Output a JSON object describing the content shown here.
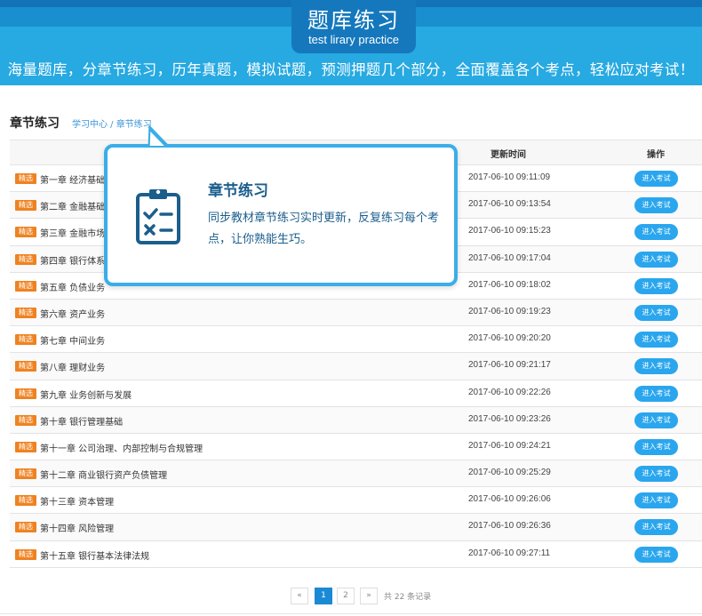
{
  "header": {
    "title_cn": "题库练习",
    "title_en": "test lirary practice",
    "slogan": "海量题库，分章节练习，历年真题，模拟试题，预测押题几个部分，全面覆盖各个考点，轻松应对考试！"
  },
  "section": {
    "title": "章节练习",
    "breadcrumb": "学习中心 / 章节练习"
  },
  "table": {
    "headers": {
      "time": "更新时间",
      "action": "操作"
    },
    "tag_label": "精选",
    "button_label": "进入考试",
    "rows": [
      {
        "chapter": "第一章 经济基础",
        "time": "2017-06-10 09:11:09"
      },
      {
        "chapter": "第二章 金融基础",
        "time": "2017-06-10 09:13:54"
      },
      {
        "chapter": "第三章 金融市场",
        "time": "2017-06-10 09:15:23"
      },
      {
        "chapter": "第四章 银行体系",
        "time": "2017-06-10 09:17:04"
      },
      {
        "chapter": "第五章 负债业务",
        "time": "2017-06-10 09:18:02"
      },
      {
        "chapter": "第六章 资产业务",
        "time": "2017-06-10 09:19:23"
      },
      {
        "chapter": "第七章 中间业务",
        "time": "2017-06-10 09:20:20"
      },
      {
        "chapter": "第八章 理财业务",
        "time": "2017-06-10 09:21:17"
      },
      {
        "chapter": "第九章 业务创新与发展",
        "time": "2017-06-10 09:22:26"
      },
      {
        "chapter": "第十章 银行管理基础",
        "time": "2017-06-10 09:23:26"
      },
      {
        "chapter": "第十一章 公司治理、内部控制与合规管理",
        "time": "2017-06-10 09:24:21"
      },
      {
        "chapter": "第十二章 商业银行资产负债管理",
        "time": "2017-06-10 09:25:29"
      },
      {
        "chapter": "第十三章 资本管理",
        "time": "2017-06-10 09:26:06"
      },
      {
        "chapter": "第十四章 风险管理",
        "time": "2017-06-10 09:26:36"
      },
      {
        "chapter": "第十五章 银行基本法律法规",
        "time": "2017-06-10 09:27:11"
      }
    ]
  },
  "pagination": {
    "prev": "«",
    "pages": [
      "1",
      "2"
    ],
    "current": "1",
    "next": "»",
    "total": "共 22 条记录"
  },
  "callout": {
    "icon": "clipboard-checklist-icon",
    "title": "章节练习",
    "description": "同步教材章节练习实时更新，反复练习每个考点，让你熟能生巧。"
  },
  "colors": {
    "banner": "#27a9e1",
    "banner_dark": "#1578bd",
    "tag": "#ef8220",
    "button": "#2aa6ee",
    "callout_border": "#3aaee8",
    "callout_text": "#1b5e8c"
  }
}
